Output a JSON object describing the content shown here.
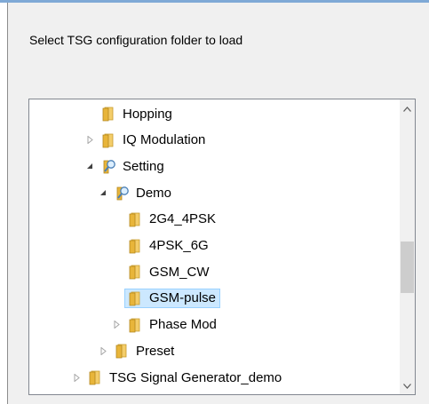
{
  "dialog": {
    "prompt": "Select TSG configuration folder to load"
  },
  "tree": {
    "items": [
      {
        "label": "Hopping",
        "level": 3,
        "expander": "none",
        "icon": "folder-icon"
      },
      {
        "label": "IQ Modulation",
        "level": 3,
        "expander": "collapsed",
        "icon": "folder-icon"
      },
      {
        "label": "Setting",
        "level": 3,
        "expander": "expanded",
        "icon": "search-folder-icon"
      },
      {
        "label": "Demo",
        "level": 4,
        "expander": "expanded",
        "icon": "search-folder-icon"
      },
      {
        "label": "2G4_4PSK",
        "level": 5,
        "expander": "none",
        "icon": "folder-icon"
      },
      {
        "label": "4PSK_6G",
        "level": 5,
        "expander": "none",
        "icon": "folder-icon"
      },
      {
        "label": "GSM_CW",
        "level": 5,
        "expander": "none",
        "icon": "folder-icon"
      },
      {
        "label": "GSM-pulse",
        "level": 5,
        "expander": "none",
        "icon": "folder-icon",
        "selected": true
      },
      {
        "label": "Phase Mod",
        "level": 5,
        "expander": "collapsed",
        "icon": "folder-icon"
      },
      {
        "label": "Preset",
        "level": 4,
        "expander": "collapsed",
        "icon": "folder-icon"
      },
      {
        "label": "TSG Signal Generator_demo",
        "level": 2,
        "expander": "collapsed",
        "icon": "folder-icon"
      }
    ]
  },
  "colors": {
    "selection_bg": "#cce8ff",
    "selection_border": "#99d1ff",
    "folder": "#e8b53a"
  }
}
